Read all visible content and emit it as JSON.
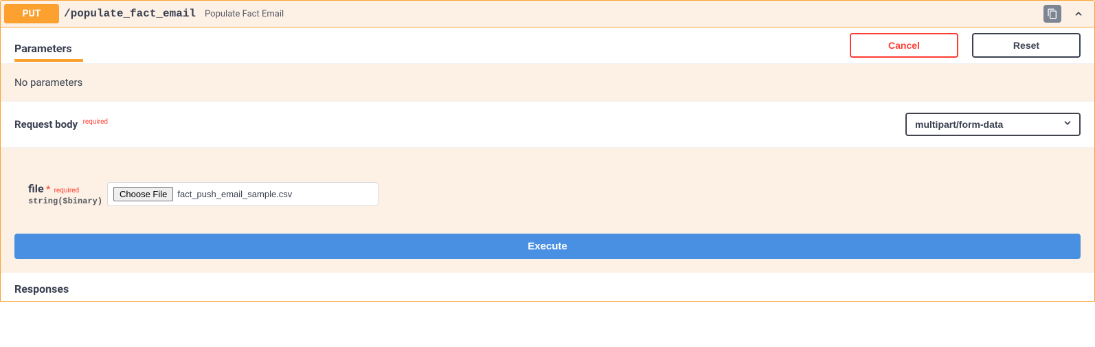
{
  "method": "PUT",
  "path": "/populate_fact_email",
  "summary": "Populate Fact Email",
  "tabs": {
    "parameters_label": "Parameters"
  },
  "buttons": {
    "cancel": "Cancel",
    "reset": "Reset",
    "execute": "Execute",
    "choose_file": "Choose File"
  },
  "parameters": {
    "empty_text": "No parameters"
  },
  "request_body": {
    "label": "Request body",
    "required_label": "required",
    "content_type": "multipart/form-data",
    "param": {
      "name": "file",
      "required_star": "*",
      "required_text": "required",
      "type": "string($binary)",
      "filename": "fact_push_email_sample.csv"
    }
  },
  "responses": {
    "label": "Responses"
  }
}
